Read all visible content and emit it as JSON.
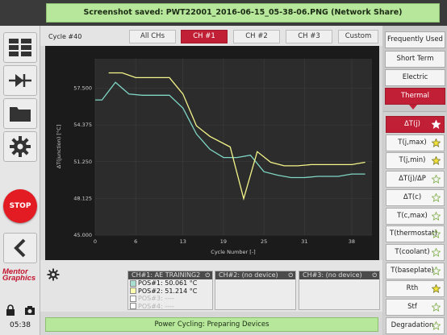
{
  "banner": {
    "text": "Screenshot saved: PWT22001_2016-06-15_05-38-06.PNG (Network Share)"
  },
  "header": {
    "cycle_label": "Cycle #40",
    "tabs": [
      {
        "label": "All CHs",
        "active": false
      },
      {
        "label": "CH #1",
        "active": true
      },
      {
        "label": "CH #2",
        "active": false
      },
      {
        "label": "CH #3",
        "active": false
      },
      {
        "label": "Custom",
        "active": false
      }
    ]
  },
  "left_panel": {
    "icons": [
      "grid-view-icon",
      "diode-icon",
      "folder-icon",
      "gear-icon",
      "back-chevron-icon"
    ],
    "stop_label": "STOP",
    "brand": [
      "Mentor",
      "Graphics"
    ],
    "clock": "05:38"
  },
  "right_panel": {
    "categories": [
      {
        "label": "Frequently Used",
        "active": false
      },
      {
        "label": "Short Term",
        "active": false
      },
      {
        "label": "Electric",
        "active": false
      },
      {
        "label": "Thermal",
        "active": true
      }
    ],
    "params": [
      {
        "label": "ΔT(j)",
        "active": true,
        "favorite": false
      },
      {
        "label": "T(j,max)",
        "active": false,
        "favorite": true
      },
      {
        "label": "T(j,min)",
        "active": false,
        "favorite": true
      },
      {
        "label": "ΔT(j)/ΔP",
        "active": false,
        "favorite": false
      },
      {
        "label": "ΔT(c)",
        "active": false,
        "favorite": false
      },
      {
        "label": "T(c,max)",
        "active": false,
        "favorite": false
      },
      {
        "label": "T(thermostat)",
        "active": false,
        "favorite": false
      },
      {
        "label": "T(coolant)",
        "active": false,
        "favorite": false
      },
      {
        "label": "T(baseplate)",
        "active": false,
        "favorite": false
      },
      {
        "label": "Rth",
        "active": false,
        "favorite": true
      },
      {
        "label": "Stf",
        "active": false,
        "favorite": false
      },
      {
        "label": "Degradation",
        "active": false,
        "favorite": false
      }
    ]
  },
  "devices": {
    "ch1": {
      "header": "CH#1: AE TRAINING2",
      "rows": [
        {
          "label": "POS#1: 50.061 °C",
          "color": "#a8dfd0",
          "enabled": true
        },
        {
          "label": "POS#2: 51.214 °C",
          "color": "#ffffb0",
          "enabled": true
        },
        {
          "label": "POS#3: ----",
          "color": "#ffffff",
          "enabled": false
        },
        {
          "label": "POS#4: ----",
          "color": "#ffffff",
          "enabled": false
        }
      ]
    },
    "ch2": {
      "header": "CH#2: (no device)"
    },
    "ch3": {
      "header": "CH#3: (no device)"
    }
  },
  "status": {
    "text": "Power Cycling: Preparing Devices"
  },
  "colors": {
    "accent_red": "#c11f36",
    "series1": "#7fd6c4",
    "series2": "#f5f58a",
    "banner_green": "#b6e79a"
  },
  "chart_data": {
    "type": "line",
    "ylabel": "ΔT(junction) [°C]",
    "xlabel": "Cycle Number [-]",
    "xlim": [
      0,
      41
    ],
    "ylim": [
      45.0,
      60.0
    ],
    "x_ticks": [
      "0",
      "6",
      "13",
      "19",
      "25",
      "31",
      "38"
    ],
    "x_tick_values": [
      0,
      6,
      13,
      19,
      25,
      31,
      38
    ],
    "y_ticks": [
      "45.000",
      "48.125",
      "51.250",
      "54.375",
      "57.500"
    ],
    "y_tick_values": [
      45.0,
      48.125,
      51.25,
      54.375,
      57.5
    ],
    "grid": true,
    "series": [
      {
        "color": "#7fd6c4",
        "x": [
          0,
          1,
          3,
          5,
          7,
          11,
          13,
          15,
          17,
          19,
          21,
          23,
          25,
          27,
          29,
          31,
          33,
          36,
          38,
          40
        ],
        "y": [
          56.5,
          56.5,
          58.0,
          57.0,
          56.9,
          56.9,
          55.8,
          53.6,
          52.3,
          51.6,
          51.6,
          51.8,
          50.4,
          50.1,
          49.9,
          49.9,
          50.0,
          50.0,
          50.2,
          50.2
        ]
      },
      {
        "color": "#f5f58a",
        "x": [
          2,
          4,
          6,
          8,
          11,
          13,
          15,
          17,
          20,
          22,
          24,
          26,
          28,
          30,
          32,
          34,
          36,
          38,
          40
        ],
        "y": [
          58.8,
          58.8,
          58.4,
          58.4,
          58.4,
          57.0,
          54.3,
          53.4,
          52.5,
          48.1,
          52.1,
          51.2,
          50.9,
          50.9,
          51.0,
          51.0,
          51.0,
          51.0,
          51.2
        ]
      }
    ]
  }
}
